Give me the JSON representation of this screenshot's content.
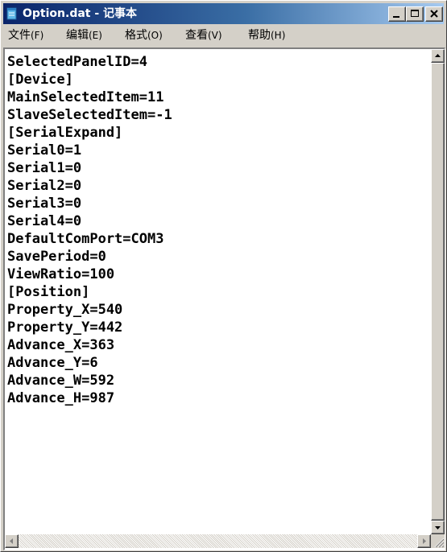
{
  "window": {
    "title": "Option.dat - 记事本"
  },
  "menu": [
    {
      "label": "文件",
      "accel": "(F)"
    },
    {
      "label": "编辑",
      "accel": "(E)"
    },
    {
      "label": "格式",
      "accel": "(O)"
    },
    {
      "label": "查看",
      "accel": "(V)"
    },
    {
      "label": "帮助",
      "accel": "(H)"
    }
  ],
  "content": {
    "lines": [
      "SelectedPanelID=4",
      "[Device]",
      "MainSelectedItem=11",
      "SlaveSelectedItem=-1",
      "[SerialExpand]",
      "Serial0=1",
      "Serial1=0",
      "Serial2=0",
      "Serial3=0",
      "Serial4=0",
      "DefaultComPort=COM3",
      "SavePeriod=0",
      "ViewRatio=100",
      "[Position]",
      "Property_X=540",
      "Property_Y=442",
      "Advance_X=363",
      "Advance_Y=6",
      "Advance_W=592",
      "Advance_H=987"
    ]
  },
  "icons": {
    "app": "notepad-icon",
    "minimize": "minimize-icon",
    "maximize": "maximize-icon",
    "close": "close-icon"
  },
  "colors": {
    "titlebar_start": "#0a246a",
    "titlebar_end": "#a6caf0",
    "chrome": "#d4d0c8"
  }
}
